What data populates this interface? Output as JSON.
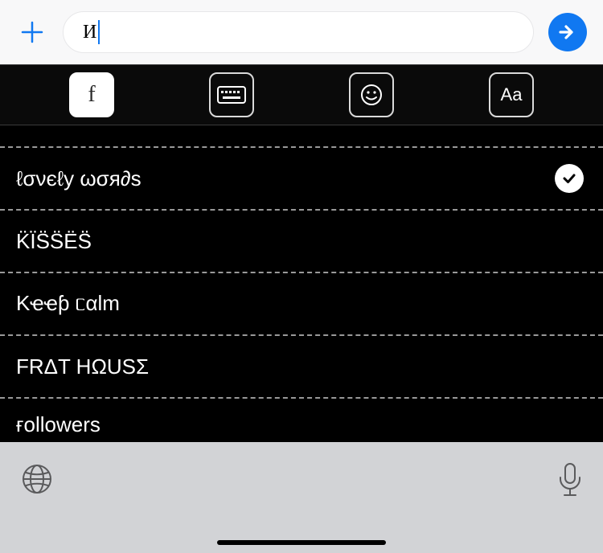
{
  "compose": {
    "value": "И",
    "placeholder": ""
  },
  "tabs": [
    {
      "id": "font",
      "glyph": "f",
      "active": true
    },
    {
      "id": "keyboard",
      "glyph": "kb",
      "active": false
    },
    {
      "id": "emoji",
      "glyph": "sm",
      "active": false
    },
    {
      "id": "size",
      "glyph": "Aa",
      "active": false
    }
  ],
  "font_styles": [
    {
      "label": "ℓσνєℓу ωσя∂ѕ",
      "selected": true
    },
    {
      "label": "K̈ÏS̈S̈ËS̈",
      "selected": false
    },
    {
      "label": "Kҽҽƥ ᥴαƖm",
      "selected": false
    },
    {
      "label": "FRΔT HΩUSΣ",
      "selected": false
    },
    {
      "label": "ғollowerѕ",
      "selected": false
    }
  ]
}
